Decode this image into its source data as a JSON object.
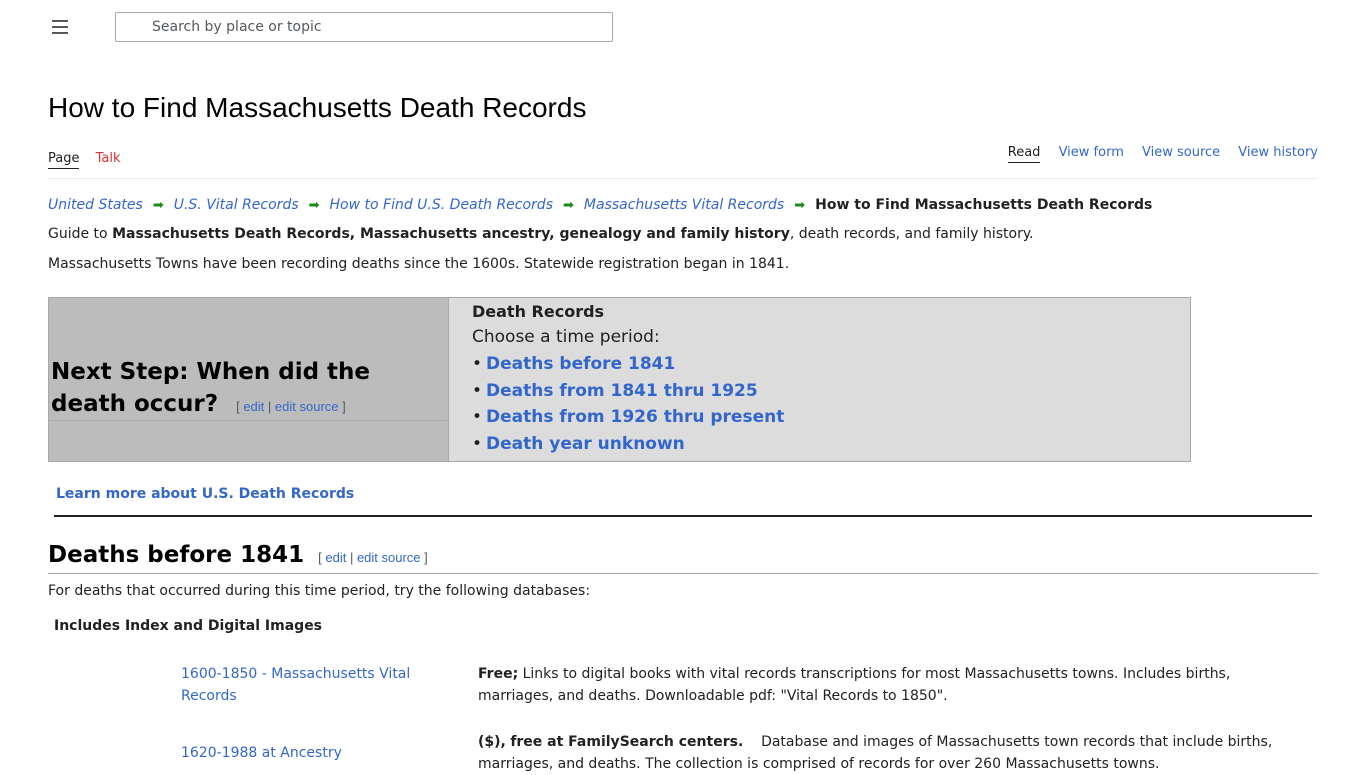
{
  "header": {
    "search_placeholder": "Search by place or topic"
  },
  "page": {
    "title": "How to Find Massachusetts Death Records",
    "tabs": {
      "page": "Page",
      "talk": "Talk"
    },
    "views": {
      "read": "Read",
      "view_form": "View form",
      "view_source": "View source",
      "view_history": "View history"
    }
  },
  "breadcrumb": {
    "items": [
      "United States",
      "U.S. Vital Records",
      "How to Find U.S. Death Records",
      "Massachusetts Vital Records"
    ],
    "arrow": "➡",
    "current": "How to Find Massachusetts Death Records"
  },
  "intro": {
    "guide_prefix": "Guide to ",
    "guide_bold": "Massachusetts Death Records, Massachusetts ancestry, genealogy and family history",
    "guide_suffix": ", death records, and family history.",
    "towns": "Massachusetts Towns have been recording deaths since the 1600s. Statewide registration began in 1841."
  },
  "next_step": {
    "heading": "Next Step: When did the death occur?",
    "edit_open": "[ ",
    "edit": "edit",
    "sep": " | ",
    "edit_source": "edit source",
    "edit_close": " ]",
    "box_title": "Death Records",
    "choose": "Choose a time period:",
    "bullet": "•",
    "items": [
      "Deaths before 1841",
      "Deaths from 1841 thru 1925",
      "Deaths from 1926 thru present",
      "Death year unknown"
    ]
  },
  "learn_more": "Learn more about U.S. Death Records",
  "section": {
    "heading": "Deaths before 1841",
    "intro": "For deaths that occurred during this time period, try the following databases:",
    "subhead": "Includes Index and Digital Images",
    "databases": [
      {
        "link": "1600-1850 - Massachusetts Vital Records",
        "prefix_bold": "Free;",
        "prefix_link": "",
        "desc": " Links to digital books with vital records transcriptions for most Massachusetts towns. Includes births, marriages, and deaths. Downloadable pdf: \"Vital Records to 1850\"."
      },
      {
        "link": "1620-1988 at Ancestry",
        "prefix_bold": "($),",
        "prefix_link": "free at FamilySearch centers.",
        "desc": "    Database and images of Massachusetts town records that include births, marriages, and deaths. The collection is comprised of records for over 260 Massachusetts towns."
      }
    ]
  }
}
